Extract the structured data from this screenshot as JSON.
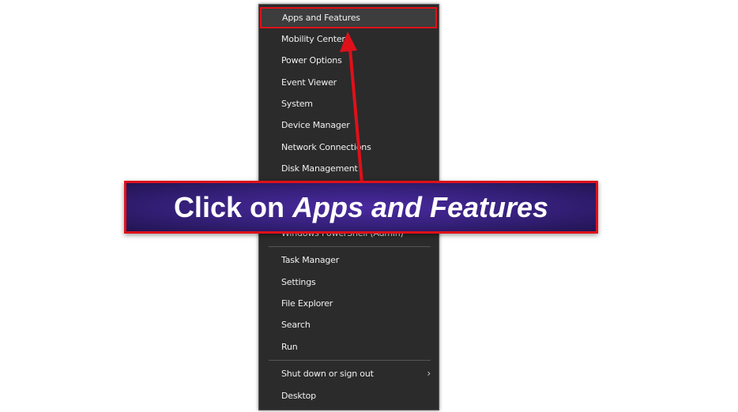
{
  "menu": {
    "items": [
      {
        "label": "Apps and Features",
        "highlighted": true
      },
      {
        "label": "Mobility Center"
      },
      {
        "label": "Power Options"
      },
      {
        "label": "Event Viewer"
      },
      {
        "label": "System"
      },
      {
        "label": "Device Manager"
      },
      {
        "label": "Network Connections"
      },
      {
        "label": "Disk Management"
      },
      {
        "label": "Windows PowerShell (Admin)"
      },
      {
        "label": "Task Manager"
      },
      {
        "label": "Settings"
      },
      {
        "label": "File Explorer"
      },
      {
        "label": "Search"
      },
      {
        "label": "Run"
      },
      {
        "label": "Shut down or sign out",
        "submenu": true
      },
      {
        "label": "Desktop"
      }
    ]
  },
  "callout": {
    "prefix": "Click on ",
    "emphasis": "Apps and Features",
    "border_color": "#e0101a",
    "background": "#3b2388"
  },
  "arrow": {
    "color": "#e0101a",
    "icon": "arrow-up-icon"
  }
}
